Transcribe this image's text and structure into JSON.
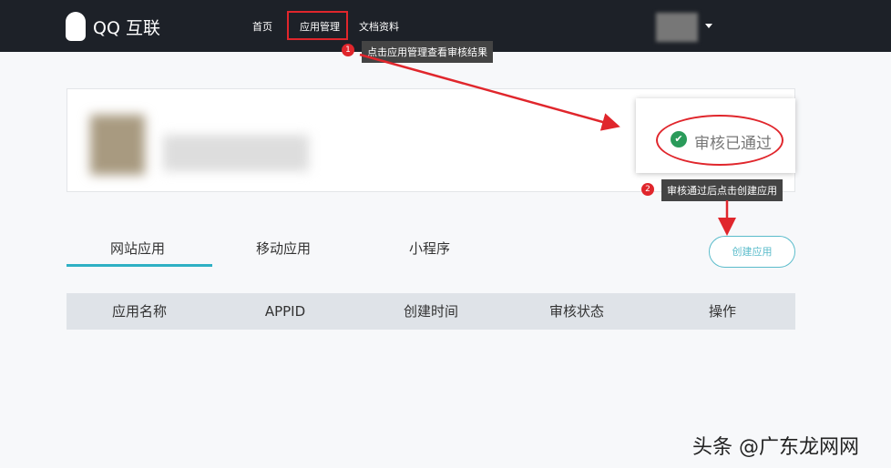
{
  "nav": {
    "brand": "QQ 互联",
    "items": [
      "首页",
      "应用管理",
      "文档资料"
    ]
  },
  "annotations": [
    {
      "num": "1",
      "text": "点击应用管理查看审核结果"
    },
    {
      "num": "2",
      "text": "审核通过后点击创建应用"
    }
  ],
  "status": {
    "text": "审核已通过",
    "icon": "check-circle-icon",
    "check": "✔"
  },
  "tabs": [
    "网站应用",
    "移动应用",
    "小程序"
  ],
  "create_button": "创建应用",
  "table": {
    "headers": [
      "应用名称",
      "APPID",
      "创建时间",
      "审核状态",
      "操作"
    ]
  },
  "watermark": "头条 @广东龙网网"
}
